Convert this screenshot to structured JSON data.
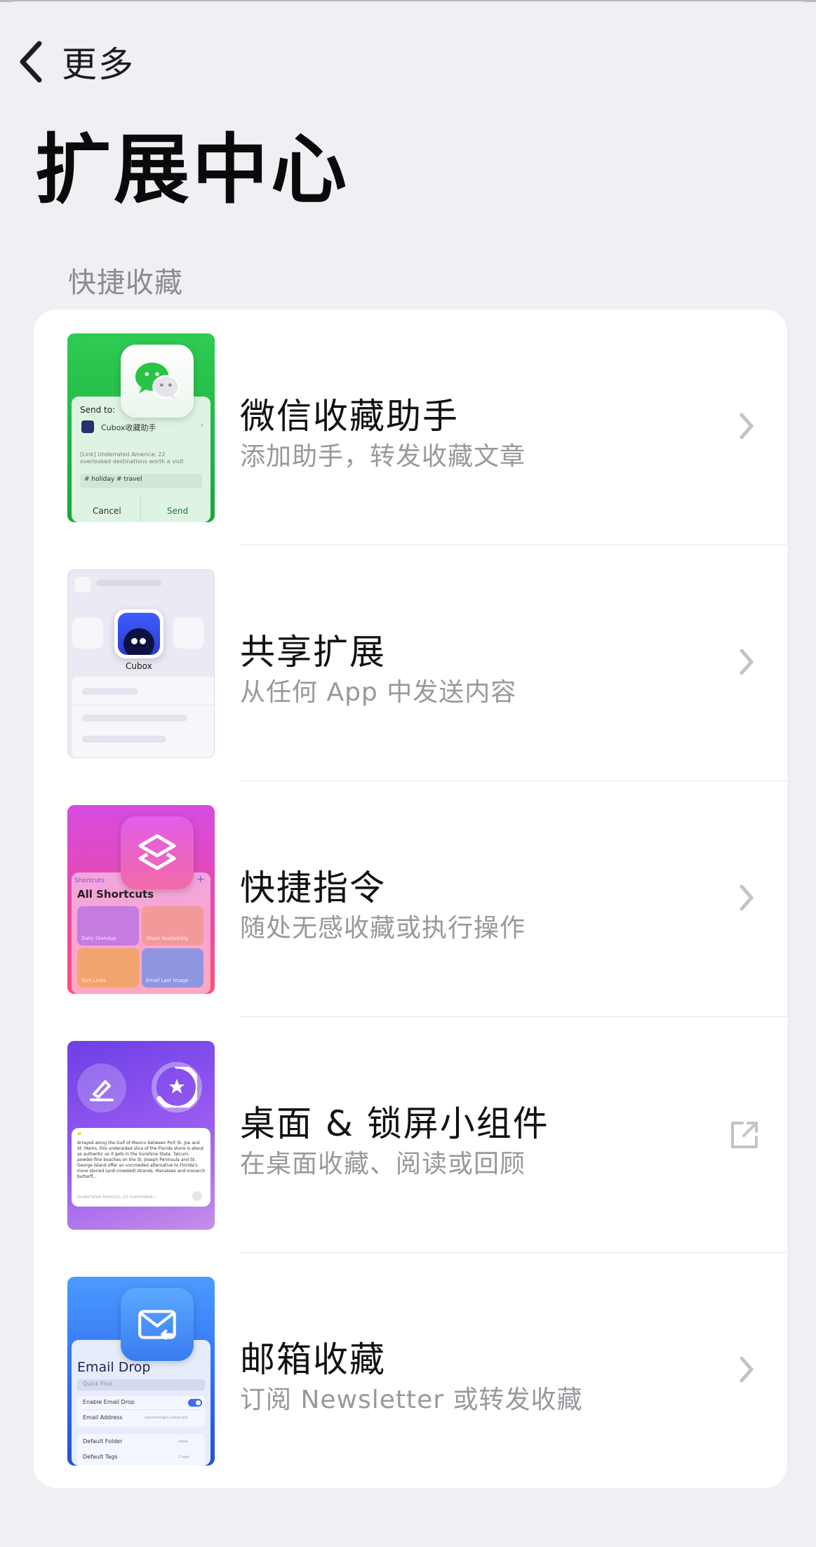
{
  "nav": {
    "back_label": "更多"
  },
  "page": {
    "title": "扩展中心"
  },
  "section": {
    "header": "快捷收藏"
  },
  "items": [
    {
      "title": "微信收藏助手",
      "subtitle": "添加助手，转发收藏文章",
      "accessory": "chevron-right-icon",
      "thumb": {
        "send_to": "Send to:",
        "contact": "Cubox收藏助手",
        "link_text": "[Link] Underrated America: 22 overlooked destinations worth a visit",
        "tags": "# holiday  # travel",
        "cancel": "Cancel",
        "send": "Send"
      }
    },
    {
      "title": "共享扩展",
      "subtitle": "从任何 App 中发送内容",
      "accessory": "chevron-right-icon",
      "thumb": {
        "app_name": "Cubox"
      }
    },
    {
      "title": "快捷指令",
      "subtitle": "随处无感收藏或执行操作",
      "accessory": "chevron-right-icon",
      "thumb": {
        "back_label": "Shortcuts",
        "heading": "All Shortcuts",
        "tiles": [
          "Daily Standup",
          "Share Availability",
          "Sort Lines",
          "Email Last Image"
        ]
      }
    },
    {
      "title": "桌面 & 锁屏小组件",
      "subtitle": "在桌面收藏、阅读或回顾",
      "accessory": "external-link-icon",
      "thumb": {
        "quote": "Arrayed along the Gulf of Mexico between Port St. Joe and St. Marks, this underaided slice of the Florida shore is about as authentic as it gets in the Sunshine State. Talcum-powder-fine beaches on the St. Joseph Peninsula and St. George Island offer an uncrowded alternative to Florida's more storied (and crowded) strands. Manatees and monarch butterfl...",
        "source": "Underrated America: 22 overlooked..."
      }
    },
    {
      "title": "邮箱收藏",
      "subtitle": "订阅 Newsletter 或转发收藏",
      "accessory": "chevron-right-icon",
      "thumb": {
        "heading": "Email Drop",
        "search": "Quick Find",
        "enable": "Enable Email Drop",
        "address_label": "Email Address",
        "address_value": "yourname@in.cubox.pro",
        "folder_label": "Default Folder",
        "folder_value": "Inbox",
        "tags_label": "Default Tags",
        "tags_value": "2 tags"
      }
    }
  ],
  "colors": {
    "background": "#efeff4",
    "card": "#ffffff",
    "title": "#111111",
    "subtitle": "#98989d",
    "section_header": "#8b8b90",
    "chevron": "#c4c4c8"
  }
}
